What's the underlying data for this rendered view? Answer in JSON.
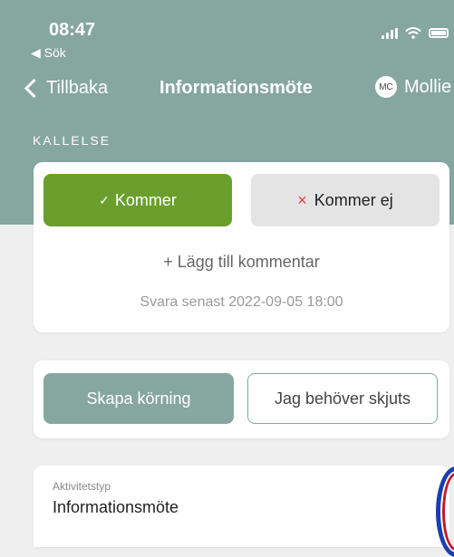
{
  "status_bar": {
    "time": "08:47",
    "back_label": "◀ Sök"
  },
  "nav": {
    "back_label": "Tillbaka",
    "title": "Informationsmöte",
    "avatar_initials": "MC",
    "user_name": "Mollie"
  },
  "section_label": "KALLELSE",
  "response": {
    "yes_check": "✓",
    "yes_label": "Kommer",
    "no_mark": "×",
    "no_label": "Kommer ej",
    "add_comment": "+ Lägg till kommentar",
    "deadline": "Svara senast 2022-09-05 18:00"
  },
  "ride": {
    "create_label": "Skapa körning",
    "need_label": "Jag behöver skjuts"
  },
  "activity": {
    "type_label": "Aktivitetstyp",
    "type_value": "Informationsmöte"
  },
  "colors": {
    "header": "#86a6a0",
    "accept": "#6a9f2d",
    "decline_mark": "#e0443a",
    "background": "#efefef"
  }
}
